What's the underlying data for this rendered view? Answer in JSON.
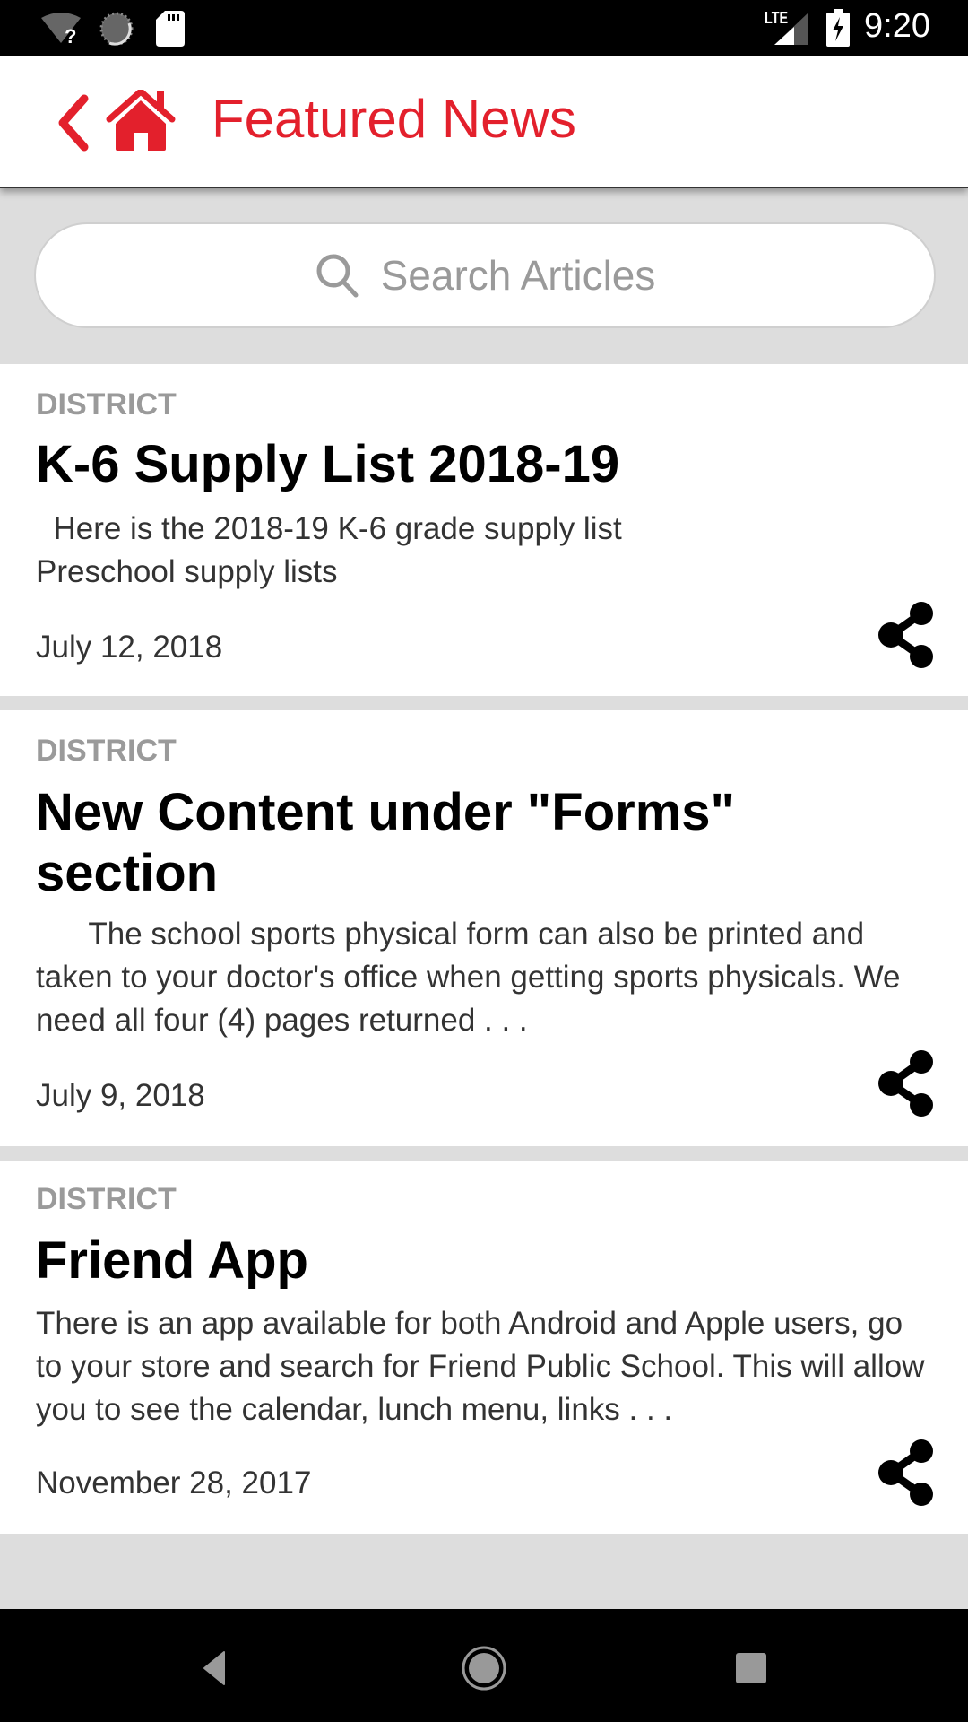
{
  "status_bar": {
    "time": "9:20",
    "network_label": "LTE",
    "icons": [
      "wifi-unknown-icon",
      "sync-icon",
      "sd-card-icon",
      "lte-signal-icon",
      "battery-charging-icon"
    ]
  },
  "app_bar": {
    "title": "Featured News",
    "back_icon": "chevron-left-icon",
    "home_icon": "home-icon",
    "accent_color": "#e3202c"
  },
  "search": {
    "placeholder": "Search Articles",
    "value": ""
  },
  "articles": [
    {
      "category": "DISTRICT",
      "title": "K-6 Supply List 2018-19",
      "excerpt": "  Here is the 2018-19 K-6 grade supply list        Preschool supply lists",
      "date": "July 12, 2018"
    },
    {
      "category": "DISTRICT",
      "title": "New Content under \"Forms\" section",
      "excerpt": "      The school sports physical form can also be printed and taken to your doctor's office when getting sports physicals. We need all four (4) pages returned . . .",
      "date": "July 9, 2018"
    },
    {
      "category": "DISTRICT",
      "title": "Friend App",
      "excerpt": "There is an app available for both Android and Apple users, go to your store and search for Friend Public School. This will allow you to see the calendar, lunch menu, links . . .",
      "date": "November 28, 2017"
    }
  ],
  "nav_bar": {
    "buttons": [
      "back-icon",
      "home-icon",
      "recents-icon"
    ]
  }
}
